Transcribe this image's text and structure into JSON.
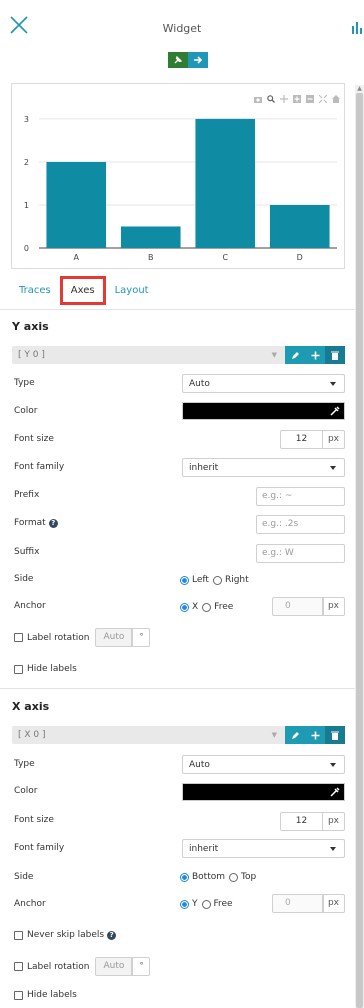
{
  "header": {
    "title": "Widget",
    "close_icon": "close-icon",
    "right_icon": "bar-chart-icon"
  },
  "toolbar": {
    "icons": [
      "pin-icon",
      "arrow-right-icon"
    ],
    "colors": {
      "green": "#2e7d32",
      "blue": "#2196b6"
    }
  },
  "modebar": {
    "icons": [
      "camera-icon",
      "zoom-icon",
      "pan-icon",
      "zoom-in-icon",
      "zoom-out-icon",
      "autoscale-icon",
      "home-icon"
    ]
  },
  "chart_data": {
    "type": "bar",
    "categories": [
      "A",
      "B",
      "C",
      "D"
    ],
    "values": [
      2,
      0.5,
      3,
      1
    ],
    "ylim": [
      0,
      3.3
    ],
    "yticks": [
      "0",
      "1",
      "2",
      "3"
    ],
    "title": "",
    "xlabel": "",
    "ylabel": "",
    "bar_color": "#0f8ba3",
    "grid": true
  },
  "tabs": [
    {
      "label": "Traces",
      "active": false
    },
    {
      "label": "Axes",
      "active": true
    },
    {
      "label": "Layout",
      "active": false
    }
  ],
  "y_axis": {
    "title": "Y axis",
    "selector": "[ Y 0 ]",
    "type_label": "Type",
    "type_value": "Auto",
    "color_label": "Color",
    "font_size_label": "Font size",
    "font_size_value": "12",
    "font_size_unit": "px",
    "font_family_label": "Font family",
    "font_family_value": "inherit",
    "prefix_label": "Prefix",
    "prefix_placeholder": "e.g.: ~",
    "format_label": "Format",
    "format_placeholder": "e.g.: .2s",
    "suffix_label": "Suffix",
    "suffix_placeholder": "e.g.: W",
    "side_label": "Side",
    "side_options": [
      "Left",
      "Right"
    ],
    "side_selected": "Left",
    "anchor_label": "Anchor",
    "anchor_options": [
      "X",
      "Free"
    ],
    "anchor_selected": "X",
    "anchor_value": "0",
    "anchor_unit": "px",
    "label_rotation_label": "Label rotation",
    "label_rotation_value": "Auto",
    "label_rotation_unit": "°",
    "hide_labels_label": "Hide labels"
  },
  "x_axis": {
    "title": "X axis",
    "selector": "[ X 0 ]",
    "type_label": "Type",
    "type_value": "Auto",
    "color_label": "Color",
    "font_size_label": "Font size",
    "font_size_value": "12",
    "font_size_unit": "px",
    "font_family_label": "Font family",
    "font_family_value": "inherit",
    "side_label": "Side",
    "side_options": [
      "Bottom",
      "Top"
    ],
    "side_selected": "Bottom",
    "anchor_label": "Anchor",
    "anchor_options": [
      "Y",
      "Free"
    ],
    "anchor_selected": "Y",
    "anchor_value": "0",
    "anchor_unit": "px",
    "never_skip_label": "Never skip labels",
    "label_rotation_label": "Label rotation",
    "label_rotation_value": "Auto",
    "label_rotation_unit": "°",
    "hide_labels_label": "Hide labels"
  }
}
